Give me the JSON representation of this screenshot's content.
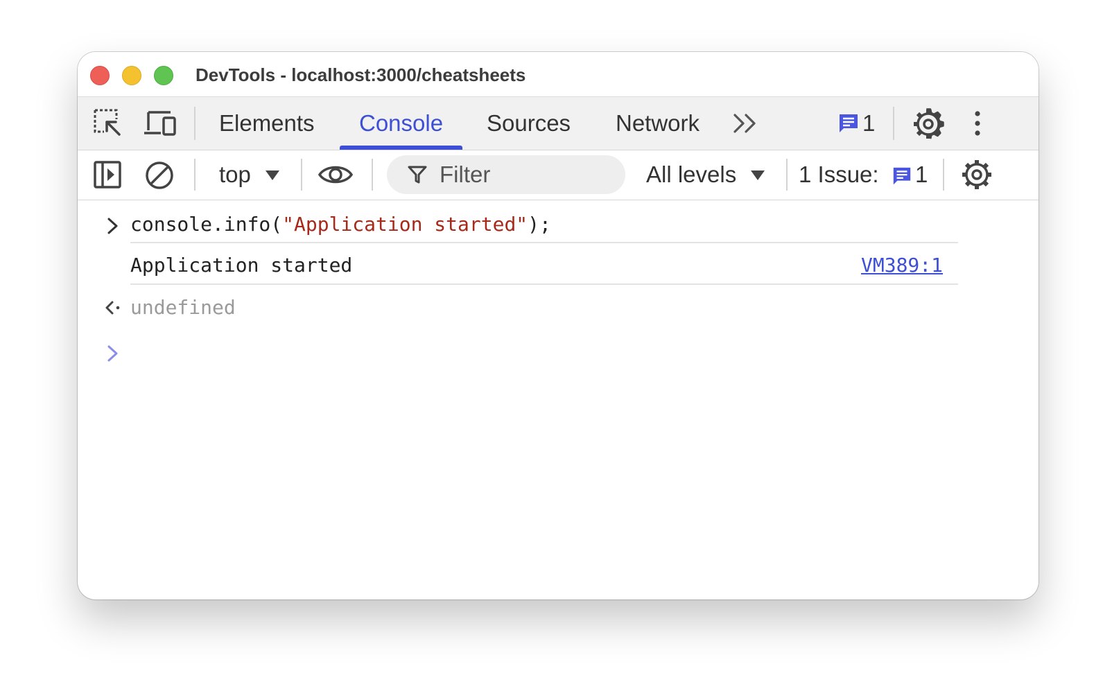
{
  "window": {
    "title": "DevTools - localhost:3000/cheatsheets"
  },
  "tabs": [
    {
      "label": "Elements",
      "active": false
    },
    {
      "label": "Console",
      "active": true
    },
    {
      "label": "Sources",
      "active": false
    },
    {
      "label": "Network",
      "active": false
    }
  ],
  "header": {
    "messages_count": "1"
  },
  "toolbar": {
    "context": "top",
    "filter_placeholder": "Filter",
    "levels": "All levels",
    "issues_label": "1 Issue:",
    "issues_count": "1"
  },
  "console": {
    "input_prefix": "console.info(",
    "input_string": "\"Application started\"",
    "input_suffix": ");",
    "output_message": "Application started",
    "output_source": "VM389:1",
    "return_value": "undefined"
  },
  "colors": {
    "accent": "#3d4fd4",
    "string": "#a52a1a",
    "muted": "#9a9a9a",
    "prompt": "#8b8ee8"
  },
  "icons": [
    "inspect-element-icon",
    "device-toolbar-icon",
    "more-tabs-icon",
    "message-icon",
    "settings-icon",
    "kebab-menu-icon",
    "sidebar-icon",
    "clear-console-icon",
    "dropdown-arrow-icon",
    "eye-icon",
    "filter-icon",
    "input-chevron-icon",
    "return-arrow-icon",
    "prompt-chevron-icon"
  ]
}
